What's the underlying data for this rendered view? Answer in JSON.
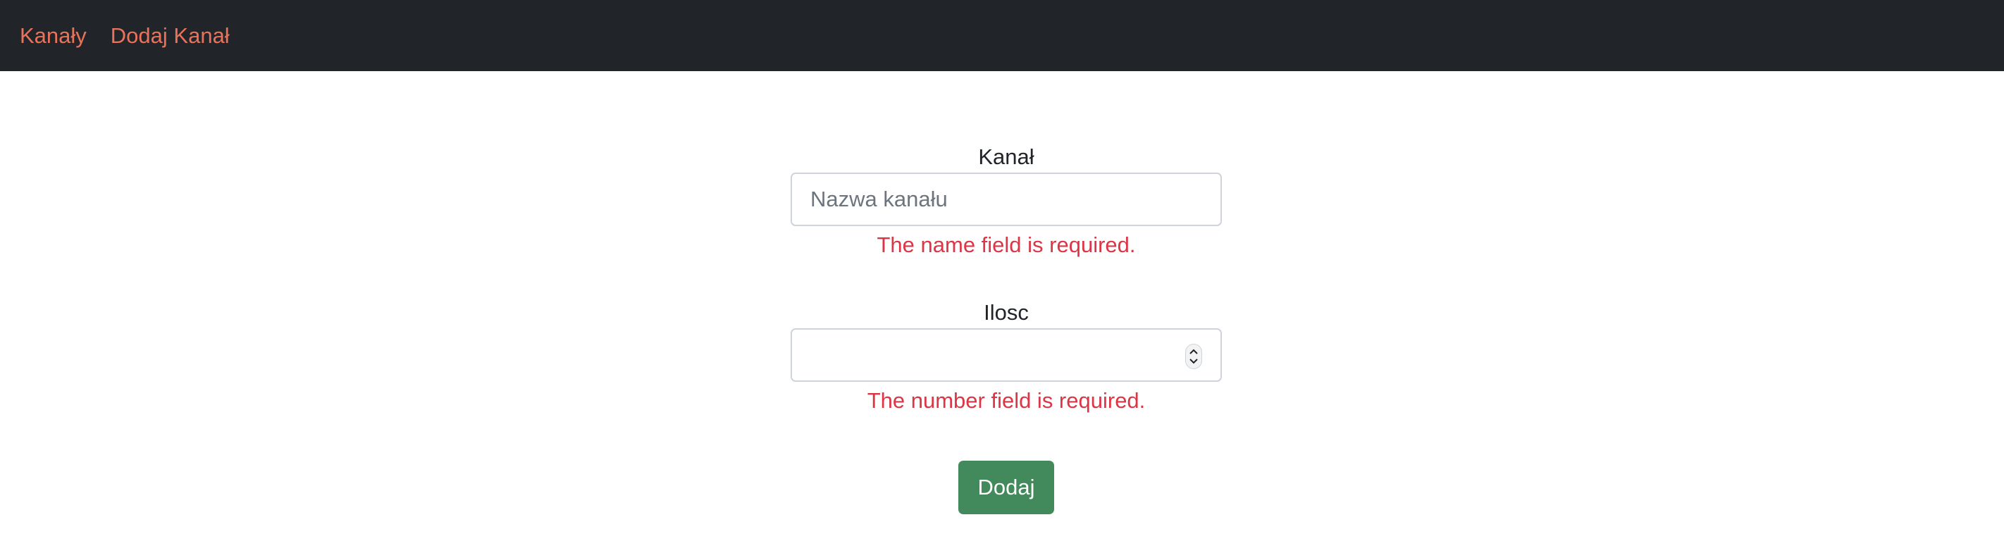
{
  "navbar": {
    "items": [
      {
        "label": "Kanały"
      },
      {
        "label": "Dodaj Kanał"
      }
    ],
    "background": "#212529",
    "link_color": "#e8735a"
  },
  "form": {
    "name_field": {
      "label": "Kanał",
      "placeholder": "Nazwa kanału",
      "value": "",
      "error": "The name field is required."
    },
    "number_field": {
      "label": "Ilosc",
      "value": "",
      "error": "The number field is required.",
      "spinner_icon": "up-down-chevron-icon"
    },
    "submit_label": "Dodaj",
    "error_color": "#dc3545",
    "button_color": "#42895b"
  }
}
